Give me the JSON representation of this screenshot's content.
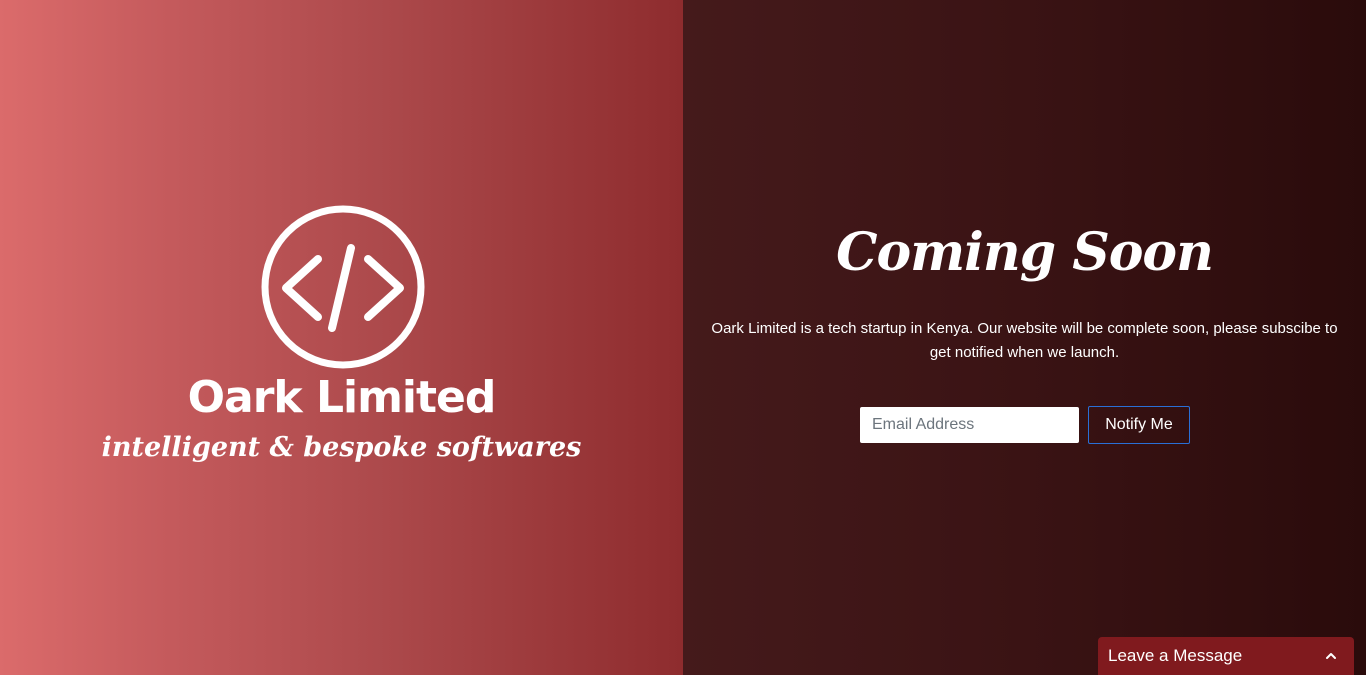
{
  "brand": {
    "name": "Oark Limited",
    "tagline": "intelligent & bespoke softwares",
    "logo_icon": "code-brackets-icon"
  },
  "main": {
    "heading": "Coming Soon",
    "description": "Oark Limited is a tech startup in Kenya. Our website will be complete soon, please subscibe to get notified when we launch."
  },
  "subscribe": {
    "email_placeholder": "Email Address",
    "email_value": "",
    "button_label": "Notify Me"
  },
  "chat": {
    "label": "Leave a Message",
    "icon": "chevron-up-icon"
  },
  "colors": {
    "left_gradient_start": "#db6b6b",
    "left_gradient_end": "#8e2c2e",
    "right_background": "#3a1314",
    "chat_background": "#801a1e",
    "button_border": "#2a6fd6"
  }
}
